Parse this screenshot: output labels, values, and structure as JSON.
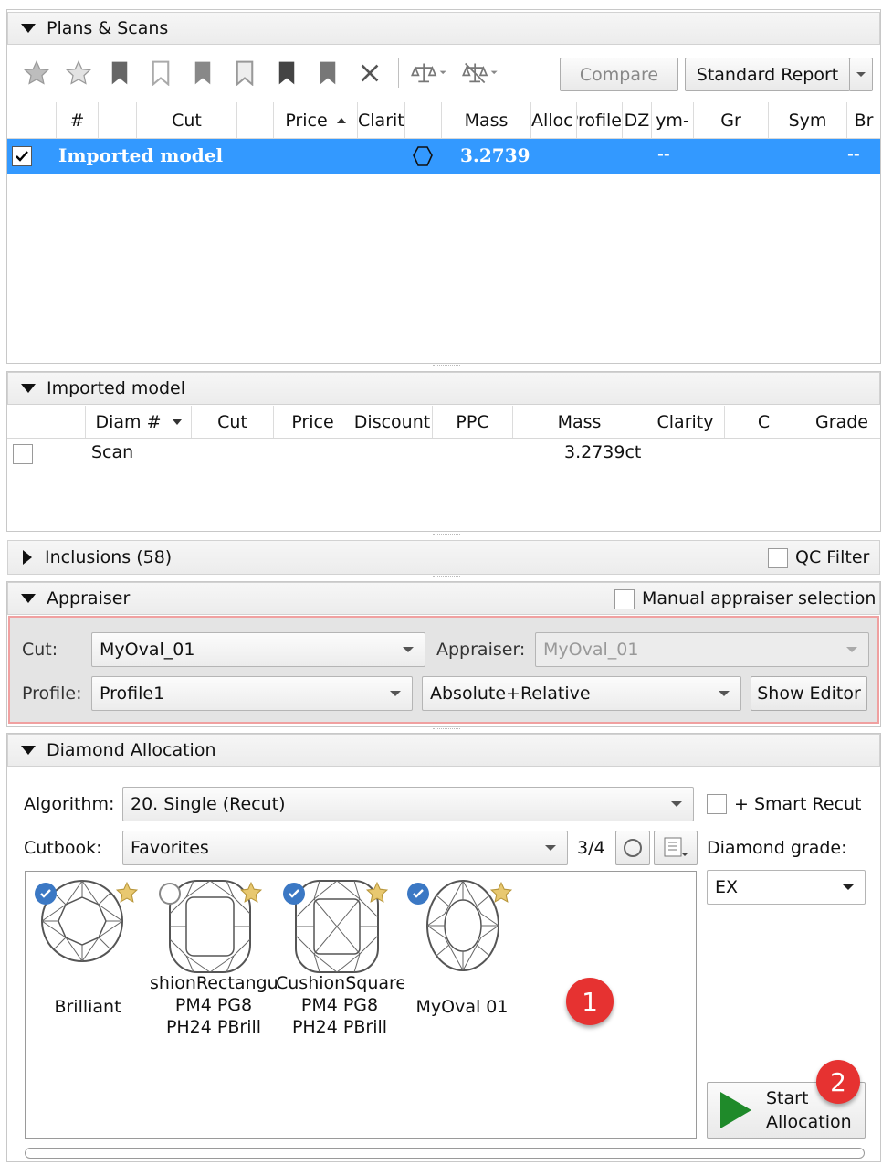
{
  "plans": {
    "header": "Plans & Scans",
    "toolbar": {
      "compare_label": "Compare",
      "report_label": "Standard Report"
    },
    "columns": [
      "#",
      "Cut",
      "Price",
      "Clarity",
      "Mass",
      "Alloc",
      "Profile",
      "DZ",
      "ym-",
      "Gr",
      "Sym",
      "Br"
    ],
    "row": {
      "name": "Imported model",
      "mass": "3.2739",
      "ym": "--",
      "br": "--"
    },
    "selection_color": "#3399ff"
  },
  "imported": {
    "header": "Imported model",
    "columns": [
      "Diam #",
      "Cut",
      "Price",
      "Discount",
      "PPC",
      "Mass",
      "Clarity",
      "C",
      "Grade"
    ],
    "row": {
      "diam": "Scan",
      "mass": "3.2739ct"
    }
  },
  "inclusions": {
    "header": "Inclusions (58)",
    "qc_filter_label": "QC Filter"
  },
  "appraiser": {
    "header": "Appraiser",
    "manual_label": "Manual appraiser selection",
    "cut_label": "Cut:",
    "cut_value": "MyOval_01",
    "appraiser_label": "Appraiser:",
    "appraiser_value": "MyOval_01",
    "profile_label": "Profile:",
    "profile_value": "Profile1",
    "mode_value": "Absolute+Relative",
    "show_editor_label": "Show Editor"
  },
  "allocation": {
    "header": "Diamond Allocation",
    "algorithm_label": "Algorithm:",
    "algorithm_value": "20. Single (Recut)",
    "smart_recut_label": "+ Smart Recut",
    "cutbook_label": "Cutbook:",
    "cutbook_value": "Favorites",
    "cutbook_count": "3/4",
    "grade_label": "Diamond grade:",
    "grade_value": "EX",
    "gems": [
      {
        "line1": "Brilliant",
        "line2": "",
        "line3": ""
      },
      {
        "line1": "shionRectangu",
        "line2": "PM4 PG8",
        "line3": "PH24 PBrill"
      },
      {
        "line1": "CushionSquare",
        "line2": "PM4 PG8",
        "line3": "PH24 PBrill"
      },
      {
        "line1": "MyOval 01",
        "line2": "",
        "line3": ""
      }
    ],
    "start_line1": "Start",
    "start_line2": "Allocation",
    "badge1": "1",
    "badge2": "2"
  }
}
